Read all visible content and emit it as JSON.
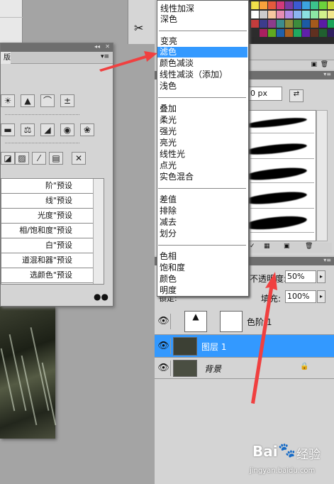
{
  "blend_menu": {
    "groups": [
      [
        "线性加深",
        "深色"
      ],
      [
        "变亮",
        "滤色",
        "颜色减淡",
        "线性减淡（添加）",
        "浅色"
      ],
      [
        "叠加",
        "柔光",
        "强光",
        "亮光",
        "线性光",
        "点光",
        "实色混合"
      ],
      [
        "差值",
        "排除",
        "减去",
        "划分"
      ],
      [
        "色相",
        "饱和度",
        "颜色",
        "明度"
      ]
    ],
    "selected": "滤色"
  },
  "adjustments": {
    "tab_label": "版",
    "presets": [
      "阶\"预设",
      "线\"预设",
      "光度\"预设",
      "相/饱和度\"预设",
      "白\"预设",
      "道混和器\"预设",
      "选颜色\"预设"
    ]
  },
  "brush": {
    "size_value": "0 px"
  },
  "layers": {
    "opacity_label": "不透明度:",
    "opacity_value": "50%",
    "fill_label": "填充:",
    "fill_value": "100%",
    "lock_label": "锁定:",
    "rows": [
      {
        "name": "色阶 1",
        "kind": "adjustment"
      },
      {
        "name": "图层 1",
        "kind": "layer",
        "selected": true
      },
      {
        "name": "背景",
        "kind": "background"
      }
    ]
  },
  "watermark": {
    "brand": "Bai",
    "brand2": "经验",
    "url": "jingyan.baidu.com"
  },
  "colors": {
    "selection": "#3399ff",
    "arrow": "#f04040",
    "panel": "#d4d4d4"
  }
}
